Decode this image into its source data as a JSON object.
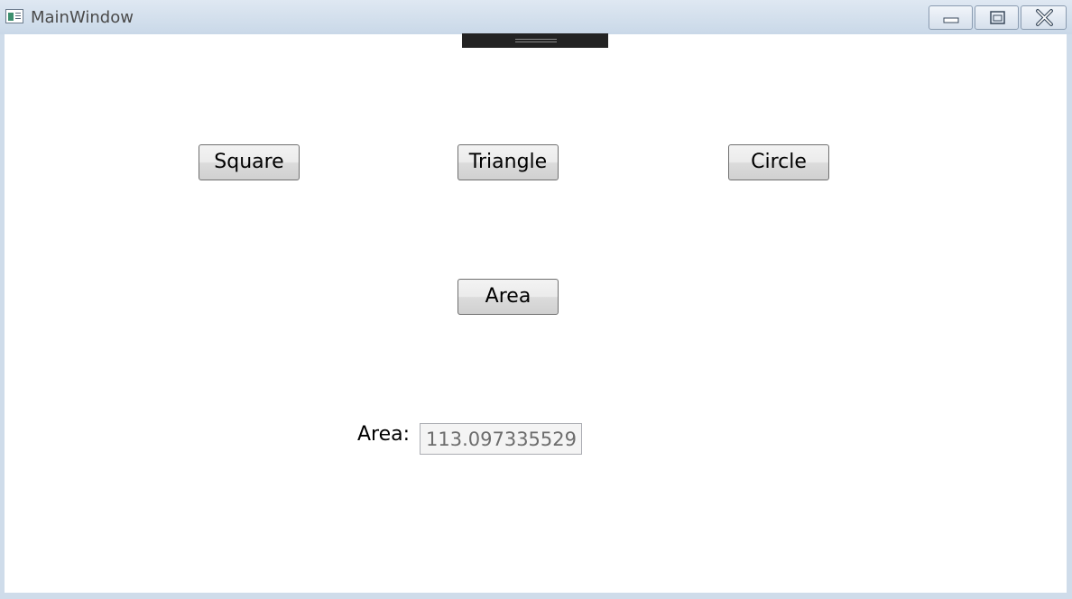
{
  "window": {
    "title": "MainWindow",
    "icon": "application-window-icon",
    "controls": {
      "minimize_icon": "minimize-icon",
      "maximize_icon": "maximize-icon",
      "close_icon": "close-icon"
    }
  },
  "shapes": {
    "square_label": "Square",
    "triangle_label": "Triangle",
    "circle_label": "Circle"
  },
  "actions": {
    "area_label": "Area"
  },
  "result": {
    "label": "Area:",
    "value": "113.097335529"
  },
  "colors": {
    "client_background": "#ffffff",
    "titlebar": "#cfdcea",
    "drag_handle": "#232323"
  }
}
